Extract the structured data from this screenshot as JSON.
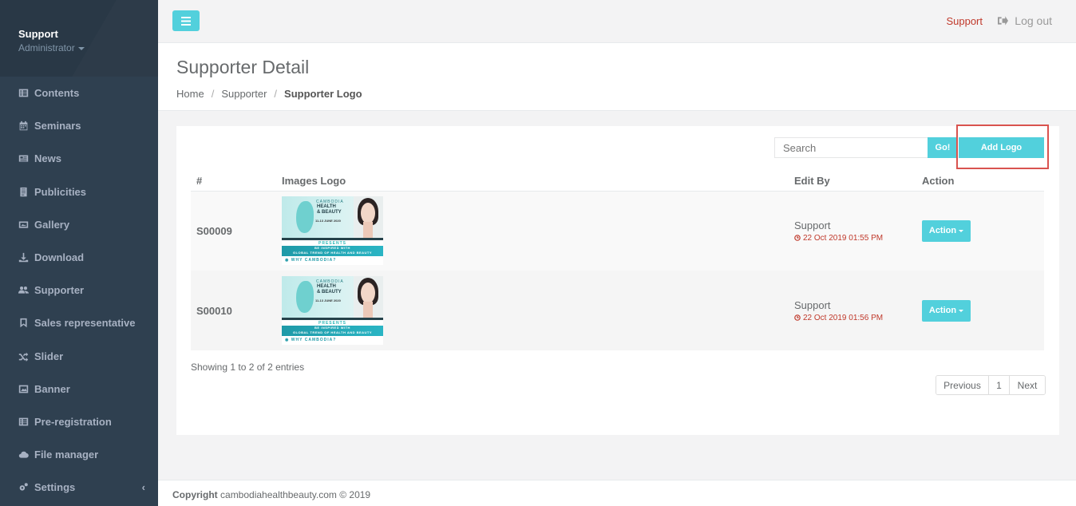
{
  "sidebar": {
    "profile": {
      "name": "Support",
      "role": "Administrator"
    },
    "items": [
      {
        "label": "Contents",
        "icon": "list-alt-icon"
      },
      {
        "label": "Seminars",
        "icon": "calendar-icon"
      },
      {
        "label": "News",
        "icon": "newspaper-icon"
      },
      {
        "label": "Publicities",
        "icon": "document-icon"
      },
      {
        "label": "Gallery",
        "icon": "image-icon"
      },
      {
        "label": "Download",
        "icon": "download-icon"
      },
      {
        "label": "Supporter",
        "icon": "users-icon"
      },
      {
        "label": "Sales representative",
        "icon": "bookmark-icon"
      },
      {
        "label": "Slider",
        "icon": "shuffle-icon"
      },
      {
        "label": "Banner",
        "icon": "picture-icon"
      },
      {
        "label": "Pre-registration",
        "icon": "list-alt-icon"
      },
      {
        "label": "File manager",
        "icon": "cloud-icon"
      },
      {
        "label": "Settings",
        "icon": "cogs-icon"
      }
    ]
  },
  "topbar": {
    "support_label": "Support",
    "logout_label": "Log out"
  },
  "heading": {
    "title": "Supporter Detail",
    "breadcrumb": [
      "Home",
      "Supporter",
      "Supporter Logo"
    ]
  },
  "toolbar": {
    "search_placeholder": "Search",
    "go_label": "Go!",
    "add_label": "Add Logo"
  },
  "table": {
    "headers": [
      "#",
      "Images Logo",
      "Edit By",
      "Action"
    ],
    "rows": [
      {
        "id": "S00009",
        "edit_by": "Support",
        "edit_time": "22 Oct 2019 01:55 PM",
        "action_label": "Action"
      },
      {
        "id": "S00010",
        "edit_by": "Support",
        "edit_time": "22 Oct 2019 01:56 PM",
        "action_label": "Action"
      }
    ],
    "logo": {
      "line1": "CAMBODIA",
      "line2": "HEALTH",
      "line3": "& BEAUTY",
      "dates": "11-13 JUNE 2020",
      "presents": "PRESENTS",
      "band_a": "BE INSPIRED WITH",
      "band_b": "GLOBAL TREND OF HEALTH AND BEAUTY",
      "why": "WHY CAMBODIA?"
    }
  },
  "pagination": {
    "showing": "Showing 1 to 2 of 2 entries",
    "previous": "Previous",
    "page": "1",
    "next": "Next"
  },
  "footer": {
    "copyright_label": "Copyright",
    "copyright_text": "cambodiahealthbeauty.com © 2019"
  },
  "colors": {
    "sidebar_bg": "#2f4050",
    "accent": "#52d0dc",
    "danger": "#c0392b"
  }
}
